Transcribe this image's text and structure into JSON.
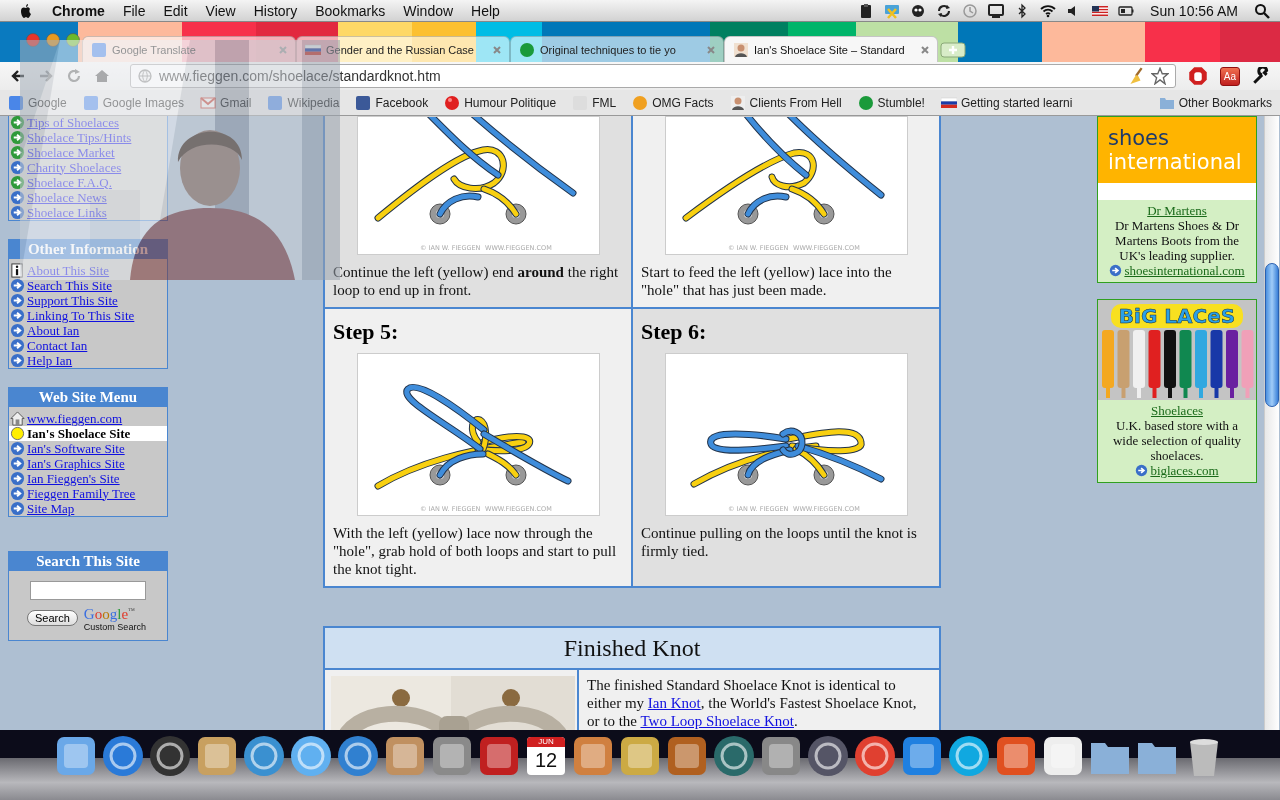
{
  "menu_bar": {
    "app": "Chrome",
    "menus": [
      "File",
      "Edit",
      "View",
      "History",
      "Bookmarks",
      "Window",
      "Help"
    ],
    "clock": "Sun 10:56 AM"
  },
  "tabs": [
    {
      "title": "Google Translate",
      "selected": false
    },
    {
      "title": "Gender and the Russian Case",
      "selected": false
    },
    {
      "title": "Original techniques to tie yo",
      "selected": false
    },
    {
      "title": "Ian's Shoelace Site – Standard",
      "selected": true
    }
  ],
  "toolbar": {
    "address": "www.fieggen.com/shoelace/standardknot.htm",
    "extension_label": "Aa"
  },
  "bookmarks": [
    {
      "label": "Google",
      "kind": "square"
    },
    {
      "label": "Google Images",
      "kind": "square"
    },
    {
      "label": "Gmail",
      "kind": "envelope"
    },
    {
      "label": "Wikipedia",
      "kind": "square"
    },
    {
      "label": "Facebook",
      "kind": "square",
      "color": "#3b5998"
    },
    {
      "label": "Humour Politique",
      "kind": "ball",
      "color": "#e02020"
    },
    {
      "label": "FML",
      "kind": "square",
      "color": "#dddddd"
    },
    {
      "label": "OMG Facts",
      "kind": "circle",
      "color": "#f0a020"
    },
    {
      "label": "Clients From Hell",
      "kind": "portrait",
      "color": "#eeeeee"
    },
    {
      "label": "Stumble!",
      "kind": "circle",
      "color": "#1a9a3a"
    },
    {
      "label": "Getting started learni",
      "kind": "flag"
    }
  ],
  "other_bookmarks": "Other Bookmarks",
  "sidebar": {
    "shoelace_links": [
      {
        "label": "Tips of Shoelaces",
        "color": "#2f9a3a"
      },
      {
        "label": "Shoelace Tips/Hints",
        "color": "#2f9a3a"
      },
      {
        "label": "Shoelace Market",
        "color": "#2f9a3a"
      },
      {
        "label": "Charity Shoelaces",
        "color": "#3a6fc8"
      },
      {
        "label": "Shoelace F.A.Q.",
        "color": "#2f9a3a"
      },
      {
        "label": "Shoelace News",
        "color": "#3a6fc8"
      },
      {
        "label": "Shoelace Links",
        "color": "#3a6fc8"
      }
    ],
    "other_information": {
      "title": "Other Information",
      "items": [
        {
          "label": "About This Site",
          "kind": "info"
        },
        {
          "label": "Search This Site",
          "kind": "arrow"
        },
        {
          "label": "Support This Site",
          "kind": "arrow"
        },
        {
          "label": "Linking To This Site",
          "kind": "arrow"
        },
        {
          "label": "About Ian",
          "kind": "arrow"
        },
        {
          "label": "Contact Ian",
          "kind": "arrow"
        },
        {
          "label": "Help Ian",
          "kind": "arrow"
        }
      ]
    },
    "web_site_menu": {
      "title": "Web Site Menu",
      "items": [
        {
          "label": "www.fieggen.com",
          "kind": "home",
          "selected": false
        },
        {
          "label": "Ian's Shoelace Site",
          "kind": "dot",
          "selected": true
        },
        {
          "label": "Ian's Software Site",
          "kind": "arrow",
          "selected": false
        },
        {
          "label": "Ian's Graphics Site",
          "kind": "arrow",
          "selected": false
        },
        {
          "label": "Ian Fieggen's Site",
          "kind": "arrow",
          "selected": false
        },
        {
          "label": "Fieggen Family Tree",
          "kind": "arrow",
          "selected": false
        },
        {
          "label": "Site Map",
          "kind": "arrow",
          "selected": false
        }
      ]
    },
    "search": {
      "title": "Search This Site",
      "button": "Search",
      "logo": "Google",
      "trademark": "™",
      "caption": "Custom Search"
    }
  },
  "steps": [
    {
      "kind": "wrap",
      "text": "Continue the left (yellow) end **around** the right loop to end up in front.",
      "credit": [
        "© IAN W. FIEGGEN",
        "WWW.FIEGGEN.COM"
      ]
    },
    {
      "kind": "feed",
      "text": "Start to feed the left (yellow) lace into the \"hole\" that has just been made.",
      "credit": [
        "© IAN W. FIEGGEN",
        "WWW.FIEGGEN.COM"
      ]
    },
    {
      "kind": "tighten",
      "title": "Step 5:",
      "text": "With the left (yellow) lace now through the \"hole\", grab hold of both loops and start to pull the knot tight.",
      "credit": [
        "© IAN W. FIEGGEN",
        "WWW.FIEGGEN.COM"
      ]
    },
    {
      "kind": "tied",
      "title": "Step 6:",
      "text": "Continue pulling on the loops until the knot is firmly tied.",
      "credit": [
        "© IAN W. FIEGGEN",
        "WWW.FIEGGEN.COM"
      ]
    }
  ],
  "finished": {
    "title": "Finished Knot",
    "parts": [
      {
        "kind": "text",
        "text": "The finished Standard Shoelace Knot is identical to either my "
      },
      {
        "kind": "link",
        "text": "Ian Knot"
      },
      {
        "kind": "text",
        "text": ", the World's Fastest Shoelace Knot, or to the "
      },
      {
        "kind": "link",
        "text": "Two Loop Shoelace Knot"
      },
      {
        "kind": "text",
        "text": "."
      }
    ]
  },
  "ads": [
    {
      "kind": "shoes",
      "banner": [
        "shoes",
        "international"
      ],
      "title": "Dr Martens",
      "text": "Dr Martens Shoes & Dr Martens Boots from the UK's leading supplier.",
      "url": "shoesinternational.com"
    },
    {
      "kind": "laces",
      "banner": [
        "BiG LACeS"
      ],
      "title": "Shoelaces",
      "text": "U.K. based store with a wide selection of quality shoelaces.",
      "url": "biglaces.com"
    }
  ],
  "dock": [
    {
      "kind": "square",
      "color": "#6aa8e8"
    },
    {
      "kind": "round",
      "color": "#2a7ad8"
    },
    {
      "kind": "round",
      "color": "#333333"
    },
    {
      "kind": "square",
      "color": "#c8a060"
    },
    {
      "kind": "round",
      "color": "#3a90d0"
    },
    {
      "kind": "round",
      "color": "#60b0f0"
    },
    {
      "kind": "round",
      "color": "#3080d0"
    },
    {
      "kind": "square",
      "color": "#c09060"
    },
    {
      "kind": "square",
      "color": "#8a8a8a"
    },
    {
      "kind": "square",
      "color": "#c02020"
    },
    {
      "kind": "calendar",
      "month": "JUN",
      "day": "12"
    },
    {
      "kind": "square",
      "color": "#d08040"
    },
    {
      "kind": "square",
      "color": "#ccaa44"
    },
    {
      "kind": "square",
      "color": "#b06020"
    },
    {
      "kind": "round",
      "color": "#2a6a6a"
    },
    {
      "kind": "square",
      "color": "#888888"
    },
    {
      "kind": "round",
      "color": "#555566"
    },
    {
      "kind": "round",
      "color": "#e04030"
    },
    {
      "kind": "square",
      "color": "#2080e0"
    },
    {
      "kind": "round",
      "color": "#10a8e0"
    },
    {
      "kind": "square",
      "color": "#e05020"
    },
    {
      "kind": "square",
      "color": "#eeeeee"
    },
    {
      "kind": "folder",
      "color": "#8ab0d8"
    },
    {
      "kind": "folder",
      "color": "#8ab0d8"
    },
    {
      "kind": "trash",
      "color": "#bbbbbb"
    }
  ]
}
